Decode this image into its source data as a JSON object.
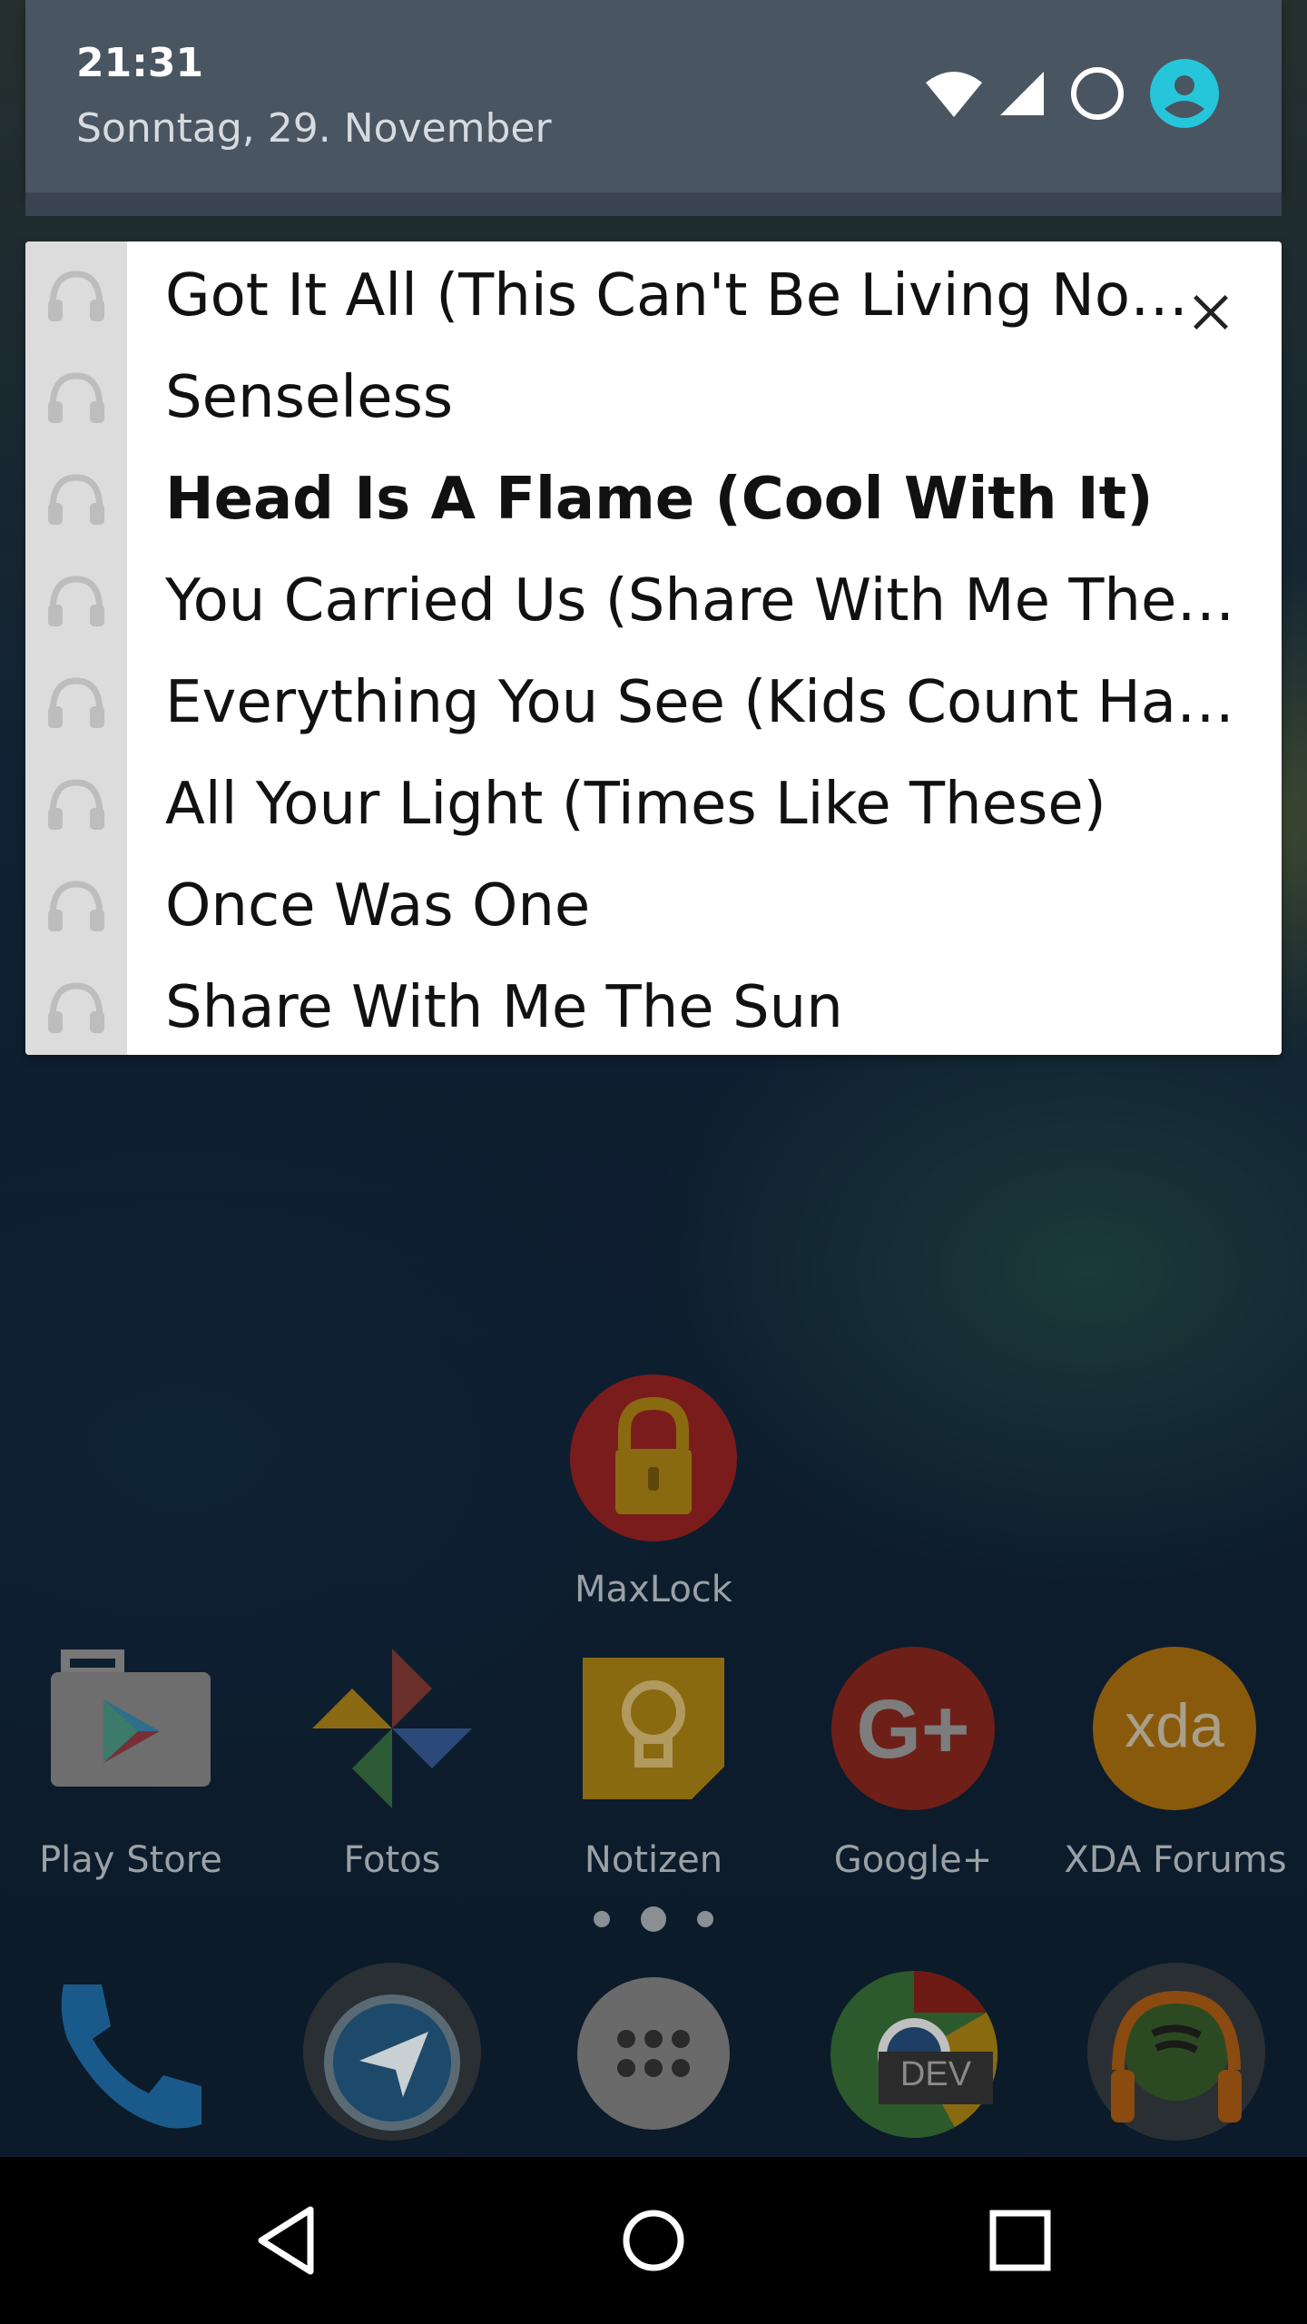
{
  "status": {
    "time": "21:31",
    "date": "Sonntag, 29. November"
  },
  "notification": {
    "tracks": [
      {
        "title": "Got It All (This Can't Be Living Now)",
        "active": false
      },
      {
        "title": "Senseless",
        "active": false
      },
      {
        "title": "Head Is A Flame (Cool With It)",
        "active": true
      },
      {
        "title": "You Carried Us (Share With Me The Sun)",
        "active": false
      },
      {
        "title": "Everything You See (Kids Count Hallelujah)",
        "active": false
      },
      {
        "title": "All Your Light (Times Like These)",
        "active": false
      },
      {
        "title": "Once Was One",
        "active": false
      },
      {
        "title": "Share With Me The Sun",
        "active": false
      }
    ],
    "icon": "headphones-icon"
  },
  "home": {
    "folder_app": {
      "label": "MaxLock",
      "icon": "lock-icon"
    },
    "apps": [
      {
        "label": "Play Store",
        "icon": "play-store-icon"
      },
      {
        "label": "Fotos",
        "icon": "pinwheel-icon"
      },
      {
        "label": "Notizen",
        "icon": "lightbulb-icon"
      },
      {
        "label": "Google+",
        "icon": "google-plus-icon"
      },
      {
        "label": "XDA Forums",
        "icon": "xda-icon"
      }
    ],
    "dock": [
      {
        "name": "phone-icon"
      },
      {
        "name": "telegram-icon"
      },
      {
        "name": "app-drawer-icon"
      },
      {
        "name": "chrome-dev-icon",
        "badge": "DEV"
      },
      {
        "name": "spotify-headphones-icon"
      }
    ],
    "page_count": 3,
    "current_page": 2
  },
  "colors": {
    "shade": "#4a5562",
    "avatar": "#26c6da",
    "card": "#ffffff",
    "icon_column": "#dcdcdc"
  }
}
